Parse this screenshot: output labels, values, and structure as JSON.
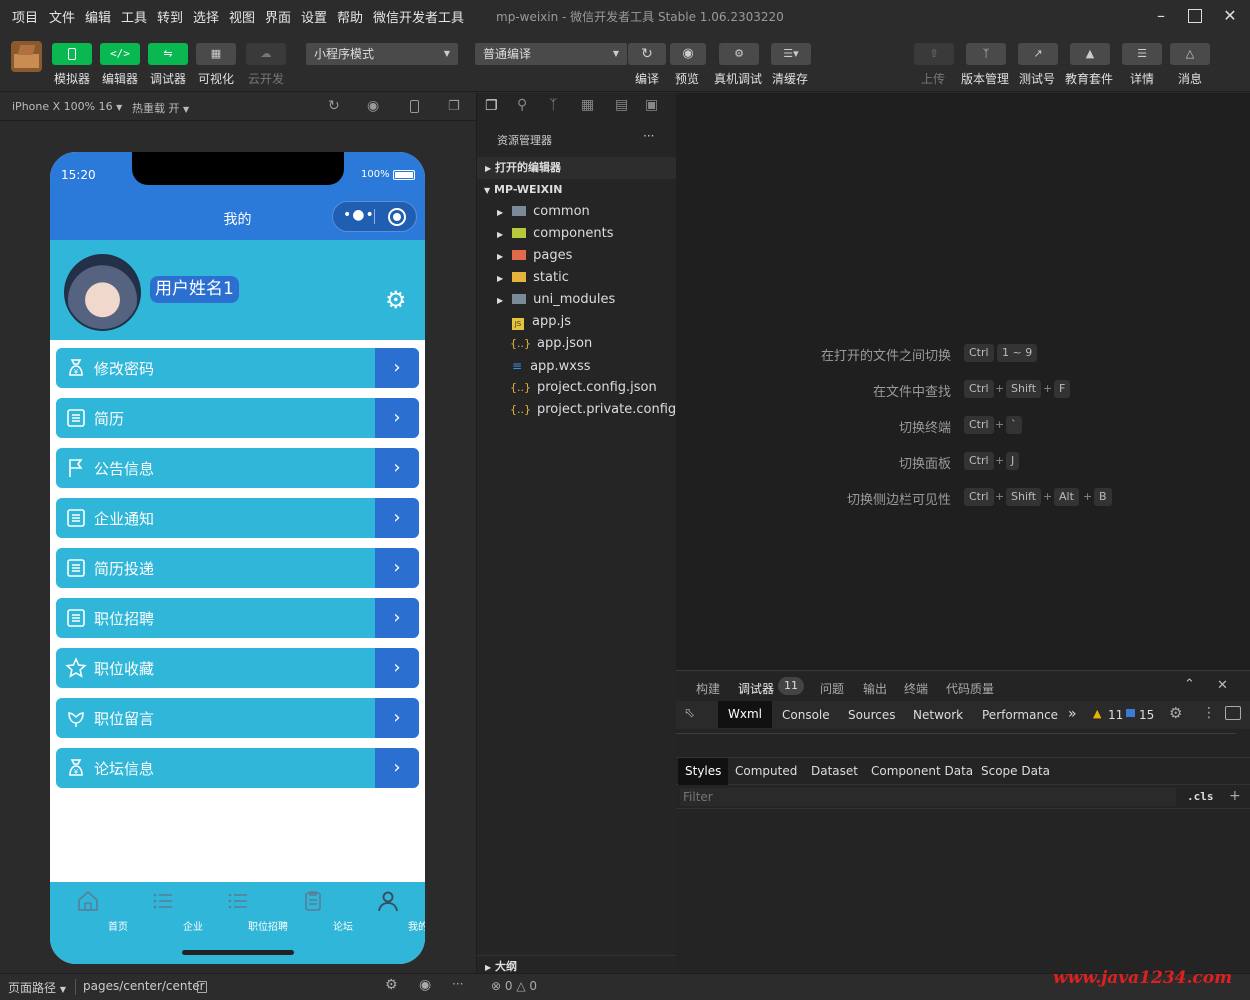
{
  "menu": {
    "items": [
      "项目",
      "文件",
      "编辑",
      "工具",
      "转到",
      "选择",
      "视图",
      "界面",
      "设置",
      "帮助",
      "微信开发者工具"
    ]
  },
  "window": {
    "title": "mp-weixin - 微信开发者工具 Stable 1.06.2303220"
  },
  "toolbar": {
    "simulator_label": "模拟器",
    "editor_label": "编辑器",
    "debugger_label": "调试器",
    "visual_label": "可视化",
    "cloud_label": "云开发",
    "mode_select": "小程序模式",
    "compile_select": "普通编译",
    "compile_label": "编译",
    "preview_label": "预览",
    "realdebug_label": "真机调试",
    "clearcache_label": "清缓存",
    "upload_label": "上传",
    "version_label": "版本管理",
    "testid_label": "测试号",
    "edu_label": "教育套件",
    "details_label": "详情",
    "messages_label": "消息"
  },
  "simulator": {
    "device": "iPhone X 100% 16",
    "hotreload": "热重载 开",
    "phone": {
      "time": "15:20",
      "battery": "100%",
      "nav_title": "我的",
      "username": "用户姓名1",
      "menu": [
        "修改密码",
        "简历",
        "公告信息",
        "企业通知",
        "简历投递",
        "职位招聘",
        "职位收藏",
        "职位留言",
        "论坛信息"
      ],
      "tabs": [
        "首页",
        "企业",
        "职位招聘",
        "论坛",
        "我的"
      ]
    }
  },
  "explorer": {
    "title": "资源管理器",
    "more": "···",
    "open_editors": "打开的编辑器",
    "project": "MP-WEIXIN",
    "folders": [
      "common",
      "components",
      "pages",
      "static",
      "uni_modules"
    ],
    "files": [
      "app.js",
      "app.json",
      "app.wxss",
      "project.config.json",
      "project.private.config.js..."
    ],
    "outline": "大纲"
  },
  "editor": {
    "shortcuts": [
      {
        "label": "在打开的文件之间切换",
        "keys": [
          "Ctrl",
          "1 ~ 9"
        ]
      },
      {
        "label": "在文件中查找",
        "keys": [
          "Ctrl",
          "Shift",
          "F"
        ]
      },
      {
        "label": "切换终端",
        "keys": [
          "Ctrl",
          "`"
        ]
      },
      {
        "label": "切换面板",
        "keys": [
          "Ctrl",
          "J"
        ]
      },
      {
        "label": "切换侧边栏可见性",
        "keys": [
          "Ctrl",
          "Shift",
          "Alt",
          "B"
        ]
      }
    ],
    "plus": "+"
  },
  "debugpanel": {
    "tabs": [
      "构建",
      "调试器",
      "问题",
      "输出",
      "终端",
      "代码质量"
    ],
    "debugger_badge": "11",
    "devtabs": [
      "Wxml",
      "Console",
      "Sources",
      "Network",
      "Performance"
    ],
    "more": "»",
    "warn_count": "11",
    "info_count": "15",
    "subtabs": [
      "Styles",
      "Computed",
      "Dataset",
      "Component Data",
      "Scope Data"
    ],
    "filter_placeholder": "Filter",
    "cls": ".cls",
    "plus": "+"
  },
  "statusbar": {
    "path_label": "页面路径",
    "path": "pages/center/center",
    "errors": "0",
    "warnings": "0",
    "watermark": "www.java1234.com",
    "more": "···"
  },
  "colors": {
    "green": "#09b850",
    "phone_blue": "#2b79d9",
    "row_cyan": "#2fb6d8",
    "row_arrow": "#2b6fd1",
    "watermark": "#e02020"
  }
}
